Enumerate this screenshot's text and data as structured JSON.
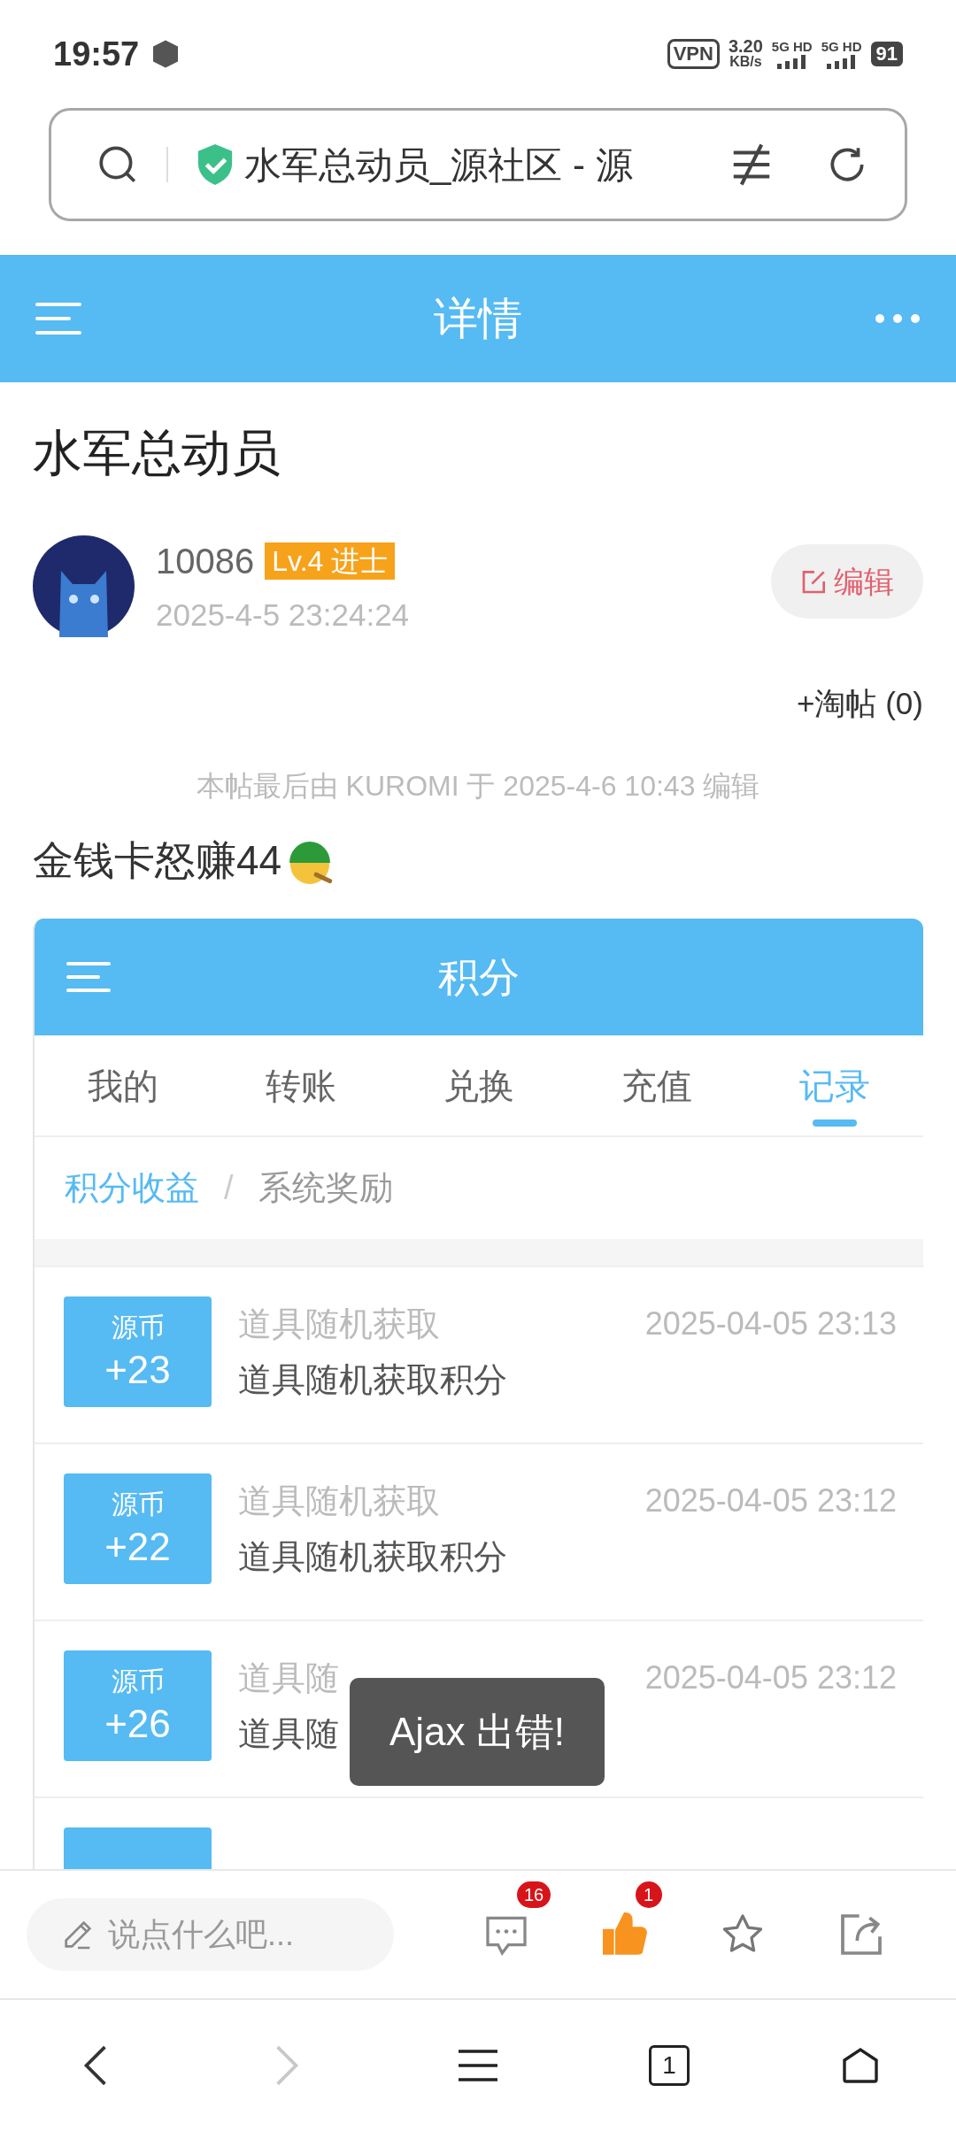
{
  "status_bar": {
    "time": "19:57",
    "vpn": "VPN",
    "speed": "3.20",
    "speed_unit": "KB/s",
    "network_1": "5G HD",
    "network_2": "5G HD",
    "battery": "91"
  },
  "address_bar": {
    "url_text": "水军总动员_源社区 - 源"
  },
  "header": {
    "title": "详情"
  },
  "post": {
    "title": "水军总动员",
    "author": {
      "name": "10086",
      "level_badge": "Lv.4 进士",
      "date": "2025-4-5 23:24:24"
    },
    "edit_button": "编辑",
    "collect_link": "+淘帖 (0)",
    "edit_note": "本帖最后由 KUROMI 于 2025-4-6 10:43 编辑",
    "content": "金钱卡怒赚44"
  },
  "embedded_screenshot": {
    "title": "积分",
    "tabs": [
      {
        "label": "我的",
        "selected": false
      },
      {
        "label": "转账",
        "selected": false
      },
      {
        "label": "兑换",
        "selected": false
      },
      {
        "label": "充值",
        "selected": false
      },
      {
        "label": "记录",
        "selected": true
      }
    ],
    "breadcrumb": [
      {
        "label": "积分收益",
        "selected": true
      },
      {
        "label": "系统奖励",
        "selected": false
      }
    ],
    "breadcrumb_separator": "/",
    "rows": [
      {
        "currency": "源币",
        "amount": "+23",
        "title": "道具随机获取",
        "time": "2025-04-05 23:13",
        "description": "道具随机获取积分"
      },
      {
        "currency": "源币",
        "amount": "+22",
        "title": "道具随机获取",
        "time": "2025-04-05 23:12",
        "description": "道具随机获取积分"
      },
      {
        "currency": "源币",
        "amount": "+26",
        "title": "道具随",
        "time": "2025-04-05 23:12",
        "description": "道具随"
      },
      {
        "kind": "cut_off"
      }
    ]
  },
  "toast": "Ajax 出错!",
  "comment_bar": {
    "placeholder": "说点什么吧...",
    "comments_badge": "16",
    "likes_badge": "1",
    "liked": true
  },
  "nav_bar": {
    "tab_count": "1",
    "forward_disabled": true
  }
}
